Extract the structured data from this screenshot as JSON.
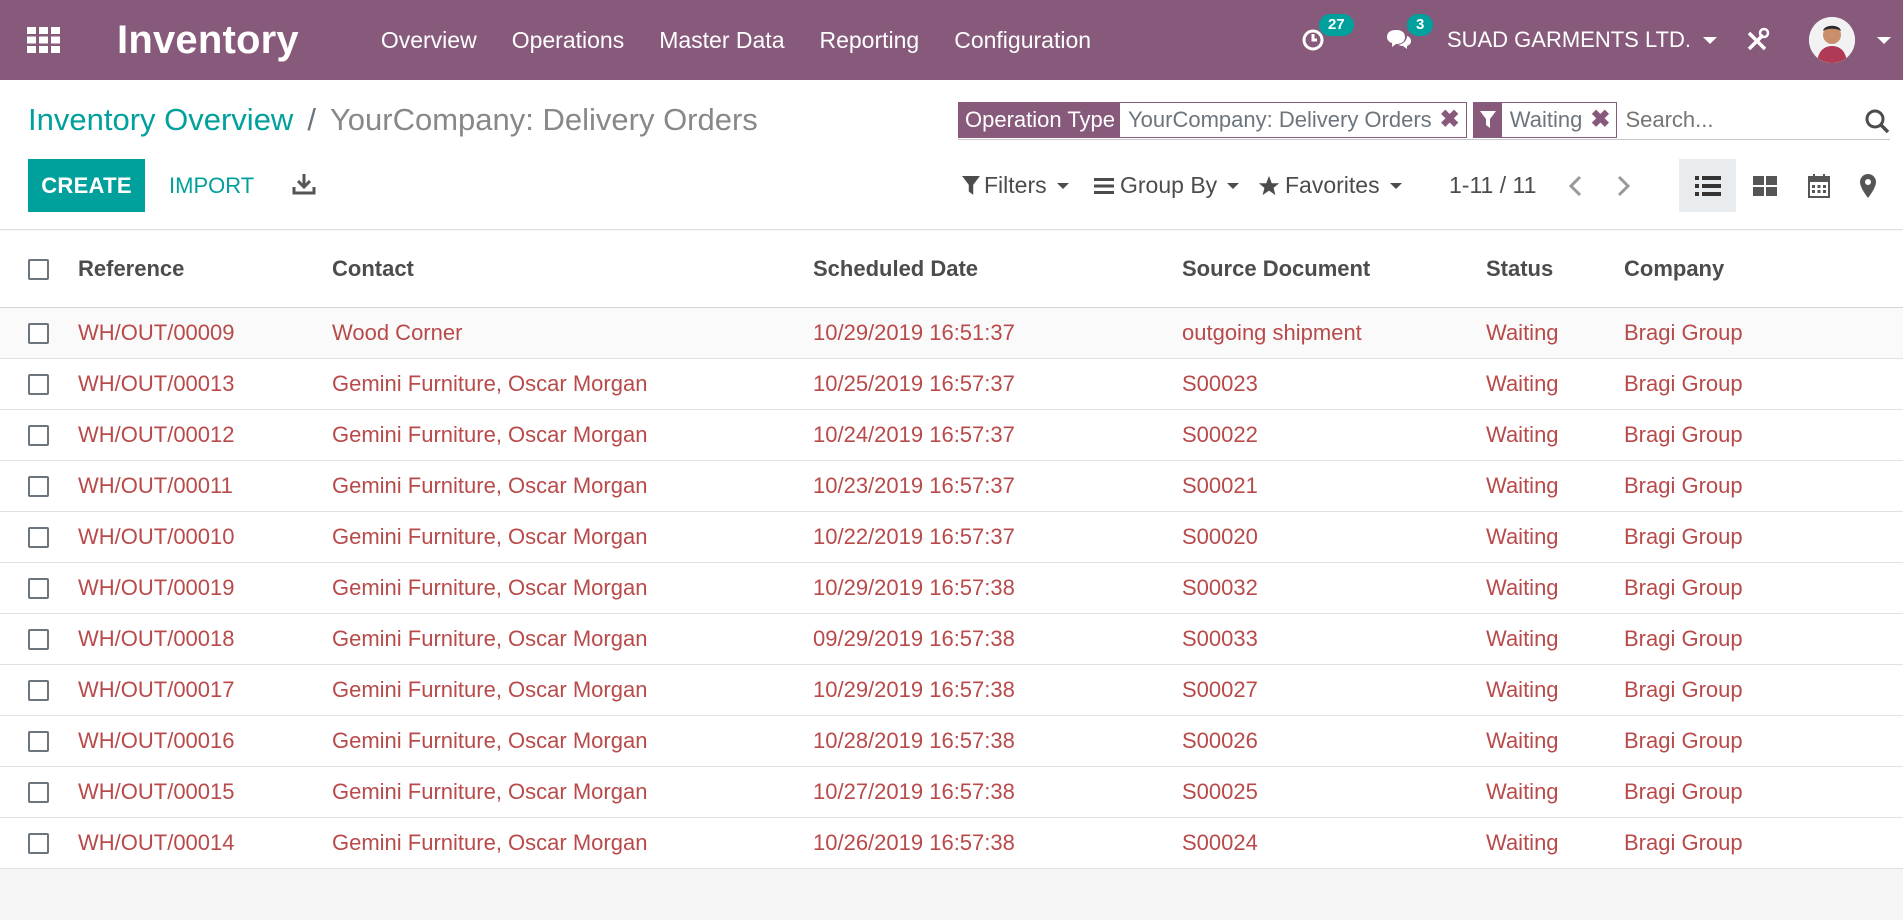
{
  "app": {
    "title": "Inventory",
    "menu": [
      "Overview",
      "Operations",
      "Master Data",
      "Reporting",
      "Configuration"
    ]
  },
  "systray": {
    "activity_count": "27",
    "message_count": "3",
    "company": "SUAD GARMENTS LTD."
  },
  "breadcrumb": {
    "parent": "Inventory Overview",
    "separator": "/",
    "current": "YourCompany: Delivery Orders"
  },
  "search": {
    "facets": [
      {
        "label": "Operation Type",
        "value": "YourCompany: Delivery Orders"
      },
      {
        "value": "Waiting"
      }
    ],
    "placeholder": "Search..."
  },
  "buttons": {
    "create": "CREATE",
    "import": "IMPORT"
  },
  "filters": {
    "filters": "Filters",
    "group_by": "Group By",
    "favorites": "Favorites"
  },
  "pager": {
    "value": "1-11 / 11"
  },
  "table": {
    "columns": [
      "Reference",
      "Contact",
      "Scheduled Date",
      "Source Document",
      "Status",
      "Company"
    ],
    "rows": [
      [
        "WH/OUT/00009",
        "Wood Corner",
        "10/29/2019 16:51:37",
        "outgoing shipment",
        "Waiting",
        "Bragi Group"
      ],
      [
        "WH/OUT/00013",
        "Gemini Furniture, Oscar Morgan",
        "10/25/2019 16:57:37",
        "S00023",
        "Waiting",
        "Bragi Group"
      ],
      [
        "WH/OUT/00012",
        "Gemini Furniture, Oscar Morgan",
        "10/24/2019 16:57:37",
        "S00022",
        "Waiting",
        "Bragi Group"
      ],
      [
        "WH/OUT/00011",
        "Gemini Furniture, Oscar Morgan",
        "10/23/2019 16:57:37",
        "S00021",
        "Waiting",
        "Bragi Group"
      ],
      [
        "WH/OUT/00010",
        "Gemini Furniture, Oscar Morgan",
        "10/22/2019 16:57:37",
        "S00020",
        "Waiting",
        "Bragi Group"
      ],
      [
        "WH/OUT/00019",
        "Gemini Furniture, Oscar Morgan",
        "10/29/2019 16:57:38",
        "S00032",
        "Waiting",
        "Bragi Group"
      ],
      [
        "WH/OUT/00018",
        "Gemini Furniture, Oscar Morgan",
        "09/29/2019 16:57:38",
        "S00033",
        "Waiting",
        "Bragi Group"
      ],
      [
        "WH/OUT/00017",
        "Gemini Furniture, Oscar Morgan",
        "10/29/2019 16:57:38",
        "S00027",
        "Waiting",
        "Bragi Group"
      ],
      [
        "WH/OUT/00016",
        "Gemini Furniture, Oscar Morgan",
        "10/28/2019 16:57:38",
        "S00026",
        "Waiting",
        "Bragi Group"
      ],
      [
        "WH/OUT/00015",
        "Gemini Furniture, Oscar Morgan",
        "10/27/2019 16:57:38",
        "S00025",
        "Waiting",
        "Bragi Group"
      ],
      [
        "WH/OUT/00014",
        "Gemini Furniture, Oscar Morgan",
        "10/26/2019 16:57:38",
        "S00024",
        "Waiting",
        "Bragi Group"
      ]
    ]
  },
  "colors": {
    "brand": "#875a7b",
    "accent": "#00a09d",
    "row_text": "#b84a4a"
  },
  "icons": {
    "apps": "apps-grid-icon",
    "activity": "clock-icon",
    "messages": "chat-icon",
    "debug": "tools-icon",
    "download": "download-icon",
    "filter": "funnel-icon",
    "group_by": "bars-icon",
    "favorites": "star-icon",
    "views": [
      "list-view-icon",
      "kanban-view-icon",
      "calendar-view-icon",
      "map-view-icon"
    ]
  }
}
